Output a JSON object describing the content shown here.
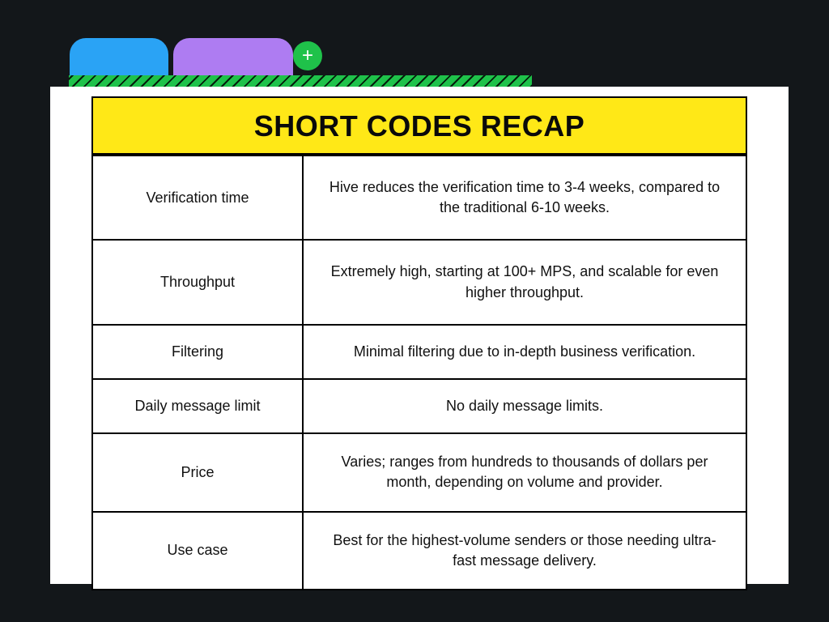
{
  "tabs": {
    "add_label": "+"
  },
  "table": {
    "title": "SHORT CODES RECAP",
    "rows": [
      {
        "key": "Verification time",
        "value": "Hive reduces the verification time to 3-4 weeks, compared to the traditional 6-10 weeks."
      },
      {
        "key": "Throughput",
        "value": "Extremely high, starting at 100+ MPS, and scalable for even higher throughput."
      },
      {
        "key": "Filtering",
        "value": "Minimal filtering due to in-depth business verification."
      },
      {
        "key": "Daily message limit",
        "value": "No daily message limits."
      },
      {
        "key": "Price",
        "value": "Varies; ranges from hundreds to thousands of dollars per month, depending on volume and provider."
      },
      {
        "key": "Use case",
        "value": "Best for the highest-volume senders or those needing ultra-fast message delivery."
      }
    ]
  }
}
